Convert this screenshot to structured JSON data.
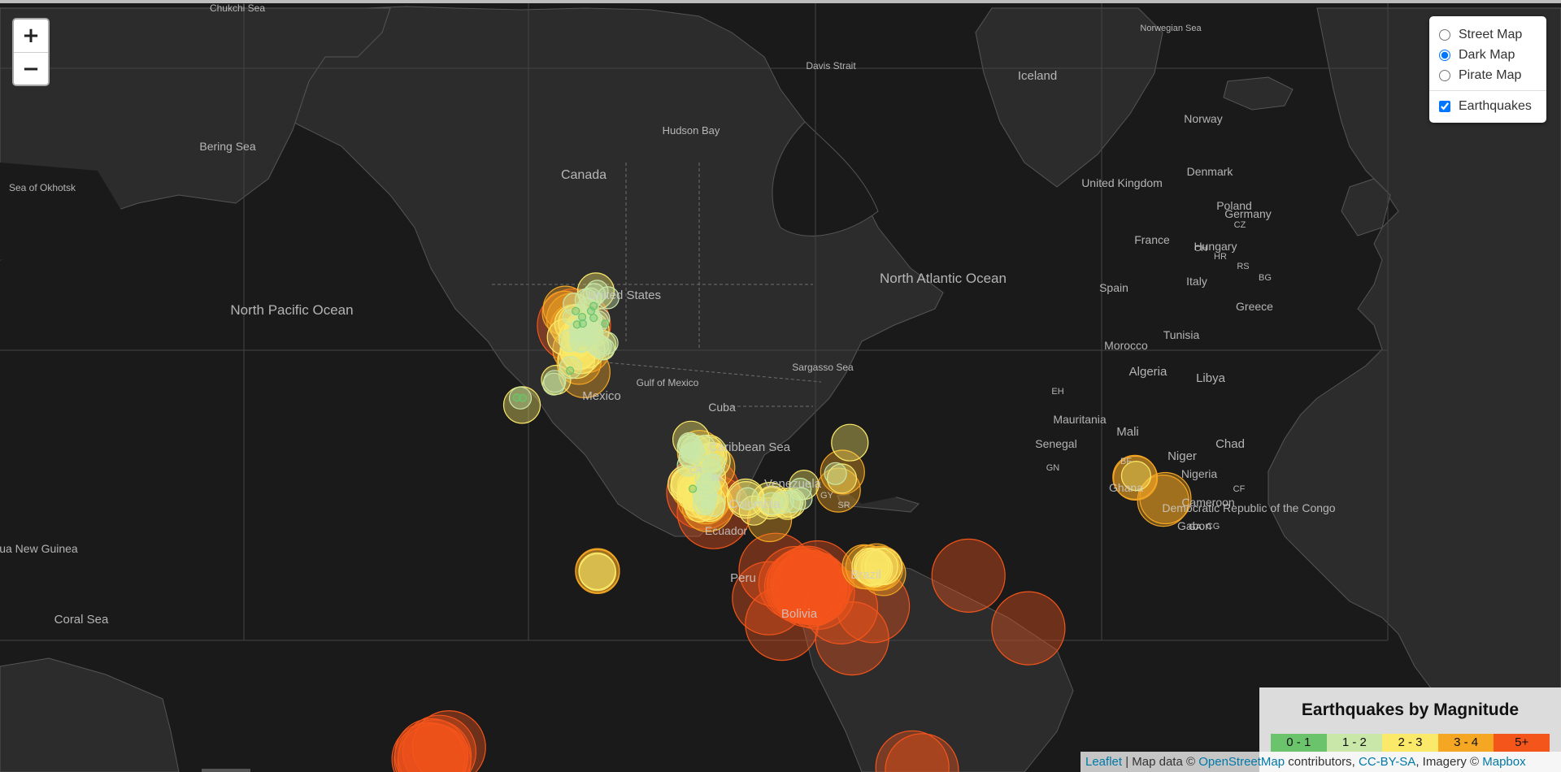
{
  "zoom": {
    "in_label": "+",
    "out_label": "−"
  },
  "layers": {
    "base": [
      {
        "label": "Street Map",
        "checked": false
      },
      {
        "label": "Dark Map",
        "checked": true
      },
      {
        "label": "Pirate Map",
        "checked": false
      }
    ],
    "overlay": {
      "label": "Earthquakes",
      "checked": true
    }
  },
  "legend": {
    "title": "Earthquakes by Magnitude",
    "items": [
      {
        "label": "0 - 1",
        "color": "#6bc46b"
      },
      {
        "label": "1 - 2",
        "color": "#c9e7a8"
      },
      {
        "label": "2 - 3",
        "color": "#fbe96a"
      },
      {
        "label": "3 - 4",
        "color": "#f5a623"
      },
      {
        "label": "5+",
        "color": "#f4551b"
      }
    ]
  },
  "attribution": {
    "leaflet": "Leaflet",
    "sep1": " | Map data © ",
    "osm": "OpenStreetMap",
    "sep2": " contributors, ",
    "license": "CC-BY-SA",
    "sep3": ", Imagery © ",
    "mapbox": "Mapbox"
  },
  "map_labels": [
    "Chukchi Sea",
    "Bering Sea",
    "Sea of Okhotsk",
    "North Pacific Ocean",
    "Canada",
    "Hudson Bay",
    "Davis Strait",
    "United States",
    "Mexico",
    "Gulf of Mexico",
    "Cuba",
    "Caribbean Sea",
    "Sargasso Sea",
    "North Atlantic Ocean",
    "Venezuela",
    "Colombia",
    "Ecuador",
    "Peru",
    "Brazil",
    "Bolivia",
    "Iceland",
    "Norway",
    "Denmark",
    "United Kingdom",
    "Poland",
    "Germany",
    "France",
    "Spain",
    "Italy",
    "Greece",
    "Hungary",
    "Morocco",
    "Tunisia",
    "Algeria",
    "Libya",
    "Mali",
    "Niger",
    "Chad",
    "Mauritania",
    "Senegal",
    "Nigeria",
    "Ghana",
    "Cameroon",
    "Gabon",
    "Democratic Republic of the Congo",
    "Papua New Guinea",
    "Coral Sea",
    "GY",
    "SR",
    "PA",
    "CR",
    "GN",
    "BF",
    "CF",
    "CG",
    "GA",
    "EH",
    "HR",
    "RS",
    "BG",
    "CZ",
    "CH",
    "Norwegian Sea"
  ],
  "basemap_colors": {
    "water": "#1a1a1a",
    "land": "#2c2c2c",
    "border": "#6e6e6e",
    "label": "#cfcfcf"
  },
  "chart_data": {
    "type": "scatter",
    "encoding": "circle position = epicenter on map, circle size and color = magnitude bin",
    "points": [
      {
        "lon": -168.5,
        "lat": 71.6,
        "mag": 3
      },
      {
        "lon": -167.0,
        "lat": 70.7,
        "mag": 1
      },
      {
        "lon": -166.3,
        "lat": 70.5,
        "mag": 3.5
      },
      {
        "lon": -165.8,
        "lat": 69.8,
        "mag": 5
      },
      {
        "lon": -164.9,
        "lat": 70.1,
        "mag": 2.5
      },
      {
        "lon": -164.8,
        "lat": 69.9,
        "mag": 0.5
      },
      {
        "lon": -166.1,
        "lat": 70.0,
        "mag": 2.5
      },
      {
        "lon": -166.2,
        "lat": 69.7,
        "mag": 3
      },
      {
        "lon": -165.2,
        "lat": 71.3,
        "mag": 0.5
      },
      {
        "lon": -163.2,
        "lat": 70.7,
        "mag": 0.5
      },
      {
        "lon": -163.0,
        "lat": 70.0,
        "mag": 0.5
      },
      {
        "lon": -161.6,
        "lat": 71.5,
        "mag": 1.5
      },
      {
        "lon": -162.0,
        "lat": 72.4,
        "mag": 1.5
      },
      {
        "lon": -160.6,
        "lat": 72.5,
        "mag": 1.5
      },
      {
        "lon": -159.4,
        "lat": 72.9,
        "mag": 1.5
      },
      {
        "lon": -158.9,
        "lat": 73.2,
        "mag": 2.5
      },
      {
        "lon": -158.5,
        "lat": 73.2,
        "mag": 1.5
      },
      {
        "lon": -160.4,
        "lat": 71.3,
        "mag": 0.5
      },
      {
        "lon": -159.6,
        "lat": 70.6,
        "mag": 0.5
      },
      {
        "lon": -158.0,
        "lat": 70.5,
        "mag": 1.5
      },
      {
        "lon": -158.4,
        "lat": 70.2,
        "mag": 1.5
      },
      {
        "lon": -165.7,
        "lat": 72.0,
        "mag": 1.5
      },
      {
        "lon": -159.6,
        "lat": 71.8,
        "mag": 0.5
      },
      {
        "lon": -168.8,
        "lat": 71.1,
        "mag": 3
      },
      {
        "lon": -160.4,
        "lat": 70.4,
        "mag": 1.5
      },
      {
        "lon": -161.7,
        "lat": 69.8,
        "mag": 2
      },
      {
        "lon": -163.6,
        "lat": 68.0,
        "mag": 1.5
      },
      {
        "lon": -164.8,
        "lat": 68.4,
        "mag": 2.5
      },
      {
        "lon": -165.2,
        "lat": 67.7,
        "mag": 2
      },
      {
        "lon": -160.4,
        "lat": 69.4,
        "mag": 1.5
      },
      {
        "lon": -163.7,
        "lat": 69.3,
        "mag": 1.5
      },
      {
        "lon": -163.9,
        "lat": 69.5,
        "mag": 2
      },
      {
        "lon": -163.8,
        "lat": 69.6,
        "mag": 2
      },
      {
        "lon": -163.5,
        "lat": 68.1,
        "mag": 1.5
      },
      {
        "lon": -161.2,
        "lat": 68.7,
        "mag": 2
      },
      {
        "lon": -163.5,
        "lat": 68.7,
        "mag": 1.5
      },
      {
        "lon": -160.5,
        "lat": 69.3,
        "mag": 2.5
      },
      {
        "lon": -163.3,
        "lat": 69.4,
        "mag": 1.5
      },
      {
        "lon": -160.4,
        "lat": 70.1,
        "mag": 1.5
      },
      {
        "lon": -161.6,
        "lat": 68.9,
        "mag": 1.5
      },
      {
        "lon": -163.2,
        "lat": 68.9,
        "mag": 2.5
      },
      {
        "lon": -162.1,
        "lat": 69.1,
        "mag": 2
      },
      {
        "lon": -164.4,
        "lat": 66.8,
        "mag": 2.5
      },
      {
        "lon": -165.5,
        "lat": 67.0,
        "mag": 3
      },
      {
        "lon": -165.0,
        "lat": 65.7,
        "mag": 2.5
      },
      {
        "lon": -164.2,
        "lat": 65.4,
        "mag": 3
      },
      {
        "lon": -162.5,
        "lat": 64.1,
        "mag": 3.5
      },
      {
        "lon": -163.5,
        "lat": 66.3,
        "mag": 2.5
      },
      {
        "lon": -161.6,
        "lat": 66.9,
        "mag": 3
      },
      {
        "lon": -161.8,
        "lat": 67.0,
        "mag": 2.5
      },
      {
        "lon": -164.3,
        "lat": 66.9,
        "mag": 2.5
      },
      {
        "lon": -168.4,
        "lat": 68.5,
        "mag": 2.5
      },
      {
        "lon": -167.0,
        "lat": 68.1,
        "mag": 1.5
      },
      {
        "lon": -157.2,
        "lat": 67.6,
        "mag": 2
      },
      {
        "lon": -156.5,
        "lat": 67.1,
        "mag": 1.5
      },
      {
        "lon": -157.5,
        "lat": 67.4,
        "mag": 1.5
      },
      {
        "lon": -158.3,
        "lat": 67.6,
        "mag": 1.5
      },
      {
        "lon": -155.4,
        "lat": 67.8,
        "mag": 1.5
      },
      {
        "lon": -155.1,
        "lat": 72.6,
        "mag": 1.5
      },
      {
        "lon": -156.0,
        "lat": 70.0,
        "mag": 0.5
      },
      {
        "lon": -166.8,
        "lat": 64.7,
        "mag": 1.5
      },
      {
        "lon": -167.0,
        "lat": 64.3,
        "mag": 0.5
      },
      {
        "lon": -171.8,
        "lat": 62.8,
        "mag": 1.5
      },
      {
        "lon": -171.4,
        "lat": 63.0,
        "mag": 2
      },
      {
        "lon": -172.1,
        "lat": 62.4,
        "mag": 1.5
      },
      {
        "lon": -183.7,
        "lat": 60.4,
        "mag": 0.5
      },
      {
        "lon": -182.6,
        "lat": 60.3,
        "mag": 1.5
      },
      {
        "lon": -181.8,
        "lat": 60.3,
        "mag": 0.5
      },
      {
        "lon": -182.1,
        "lat": 59.2,
        "mag": 2.5
      },
      {
        "lon": -129.0,
        "lat": 53.2,
        "mag": 2.5
      },
      {
        "lon": -129.6,
        "lat": 52.4,
        "mag": 1.5
      },
      {
        "lon": -129.5,
        "lat": 52.1,
        "mag": 1.5
      },
      {
        "lon": -129.9,
        "lat": 51.8,
        "mag": 1.5
      },
      {
        "lon": -128.6,
        "lat": 51.4,
        "mag": 1.5
      },
      {
        "lon": -127.6,
        "lat": 51.2,
        "mag": 2
      },
      {
        "lon": -128.2,
        "lat": 50.6,
        "mag": 1.5
      },
      {
        "lon": -129.8,
        "lat": 50.2,
        "mag": 1
      },
      {
        "lon": -129.4,
        "lat": 49.9,
        "mag": 1.5
      },
      {
        "lon": -128.1,
        "lat": 49.9,
        "mag": 2
      },
      {
        "lon": -126.4,
        "lat": 50.7,
        "mag": 3
      },
      {
        "lon": -129.9,
        "lat": 48.1,
        "mag": 1.5
      },
      {
        "lon": -125.0,
        "lat": 51.9,
        "mag": 1.5
      },
      {
        "lon": -123.4,
        "lat": 50.9,
        "mag": 2
      },
      {
        "lon": -123.6,
        "lat": 50.5,
        "mag": 2.5
      },
      {
        "lon": -122.4,
        "lat": 49.6,
        "mag": 2
      },
      {
        "lon": -122.5,
        "lat": 49.0,
        "mag": 2.5
      },
      {
        "lon": -121.9,
        "lat": 48.1,
        "mag": 1.5
      },
      {
        "lon": -123.1,
        "lat": 49.6,
        "mag": 2
      },
      {
        "lon": -122.2,
        "lat": 47.6,
        "mag": 3
      },
      {
        "lon": -122.9,
        "lat": 47.0,
        "mag": 1.5
      },
      {
        "lon": -122.3,
        "lat": 48.7,
        "mag": 1
      },
      {
        "lon": -122.8,
        "lat": 45.5,
        "mag": 2
      },
      {
        "lon": -123.7,
        "lat": 44.9,
        "mag": 1
      },
      {
        "lon": -124.2,
        "lat": 45.0,
        "mag": 1.5
      },
      {
        "lon": -123.5,
        "lat": 43.9,
        "mag": 1.5
      },
      {
        "lon": -123.9,
        "lat": 43.3,
        "mag": 1.5
      },
      {
        "lon": -130.7,
        "lat": 44.4,
        "mag": 2
      },
      {
        "lon": -130.5,
        "lat": 44.0,
        "mag": 2.5
      },
      {
        "lon": -129.7,
        "lat": 43.5,
        "mag": 2.5
      },
      {
        "lon": -129.4,
        "lat": 43.9,
        "mag": 2.5
      },
      {
        "lon": -128.6,
        "lat": 43.7,
        "mag": 2
      },
      {
        "lon": -128.4,
        "lat": 43.2,
        "mag": 3
      },
      {
        "lon": -128.5,
        "lat": 42.9,
        "mag": 0.5
      },
      {
        "lon": -127.3,
        "lat": 42.6,
        "mag": 2.5
      },
      {
        "lon": -127.1,
        "lat": 42.0,
        "mag": 2.5
      },
      {
        "lon": -125.2,
        "lat": 42.0,
        "mag": 5
      },
      {
        "lon": -125.2,
        "lat": 42.3,
        "mag": 2.5
      },
      {
        "lon": -126.4,
        "lat": 42.1,
        "mag": 2
      },
      {
        "lon": -125.7,
        "lat": 41.0,
        "mag": 2
      },
      {
        "lon": -126.4,
        "lat": 40.4,
        "mag": 3
      },
      {
        "lon": -127.7,
        "lat": 41.9,
        "mag": 2.5
      },
      {
        "lon": -125.0,
        "lat": 41.4,
        "mag": 1.5
      },
      {
        "lon": -125.0,
        "lat": 40.5,
        "mag": 2
      },
      {
        "lon": -124.3,
        "lat": 39.8,
        "mag": 3
      },
      {
        "lon": -124.9,
        "lat": 39.3,
        "mag": 1.5
      },
      {
        "lon": -123.8,
        "lat": 38.8,
        "mag": 3.5
      },
      {
        "lon": -123.1,
        "lat": 38.6,
        "mag": 2
      },
      {
        "lon": -123.7,
        "lat": 40.4,
        "mag": 3
      },
      {
        "lon": -126.9,
        "lat": 39.6,
        "mag": 2
      },
      {
        "lon": -124.0,
        "lat": 39.9,
        "mag": 2.5
      },
      {
        "lon": -124.5,
        "lat": 38.9,
        "mag": 1
      },
      {
        "lon": -124.5,
        "lat": 40.8,
        "mag": 1.5
      },
      {
        "lon": -122.1,
        "lat": 42.7,
        "mag": 2
      },
      {
        "lon": -121.8,
        "lat": 39.0,
        "mag": 1.5
      },
      {
        "lon": -126.3,
        "lat": 38.5,
        "mag": 2
      },
      {
        "lon": -121.9,
        "lat": 37.3,
        "mag": 5
      },
      {
        "lon": -111.9,
        "lat": 40.9,
        "mag": 2.5
      },
      {
        "lon": -111.8,
        "lat": 40.3,
        "mag": 2.5
      },
      {
        "lon": -111.3,
        "lat": 40.6,
        "mag": 1.5
      },
      {
        "lon": -104.3,
        "lat": 40.1,
        "mag": 2.5
      },
      {
        "lon": -103.7,
        "lat": 40.1,
        "mag": 2
      },
      {
        "lon": -103.7,
        "lat": 39.8,
        "mag": 2
      },
      {
        "lon": -103.8,
        "lat": 39.4,
        "mag": 1.5
      },
      {
        "lon": -109.3,
        "lat": 37.7,
        "mag": 2
      },
      {
        "lon": -104.4,
        "lat": 35.4,
        "mag": 3
      },
      {
        "lon": -100.3,
        "lat": 39.7,
        "mag": 1.5
      },
      {
        "lon": -99.3,
        "lat": 39.6,
        "mag": 2
      },
      {
        "lon": -98.8,
        "lat": 39.1,
        "mag": 2
      },
      {
        "lon": -97.7,
        "lat": 39.6,
        "mag": 2
      },
      {
        "lon": -97.3,
        "lat": 39.9,
        "mag": 1.5
      },
      {
        "lon": -94.8,
        "lat": 42.8,
        "mag": 1.5
      },
      {
        "lon": -93.6,
        "lat": 43.8,
        "mag": 2
      },
      {
        "lon": -94.5,
        "lat": 40.6,
        "mag": 1.5
      },
      {
        "lon": -79.2,
        "lat": 52.6,
        "mag": 2.5
      },
      {
        "lon": -83.7,
        "lat": 46.3,
        "mag": 1.5
      },
      {
        "lon": -81.5,
        "lat": 46.6,
        "mag": 3
      },
      {
        "lon": -81.7,
        "lat": 45.2,
        "mag": 2
      },
      {
        "lon": -82.8,
        "lat": 42.6,
        "mag": 3
      },
      {
        "lon": -158.4,
        "lat": 21.1,
        "mag": 3
      },
      {
        "lon": -158.4,
        "lat": 21.4,
        "mag": 3
      },
      {
        "lon": -158.5,
        "lat": 21.2,
        "mag": 2.5
      },
      {
        "lon": -158.4,
        "lat": 20.9,
        "mag": 2.5
      },
      {
        "lon": -102.5,
        "lat": 21.6,
        "mag": 5
      },
      {
        "lon": -104.6,
        "lat": 13.1,
        "mag": 5
      },
      {
        "lon": -96.3,
        "lat": 17.7,
        "mag": 5
      },
      {
        "lon": -94.5,
        "lat": 16.6,
        "mag": 5
      },
      {
        "lon": -93.8,
        "lat": 16.8,
        "mag": 5
      },
      {
        "lon": -93.4,
        "lat": 17.4,
        "mag": 5
      },
      {
        "lon": -92.6,
        "lat": 17.8,
        "mag": 5
      },
      {
        "lon": -92.3,
        "lat": 16.5,
        "mag": 5
      },
      {
        "lon": -92.0,
        "lat": 15.4,
        "mag": 5
      },
      {
        "lon": -91.8,
        "lat": 16.6,
        "mag": 5
      },
      {
        "lon": -91.6,
        "lat": 16.2,
        "mag": 5
      },
      {
        "lon": -90.8,
        "lat": 16.3,
        "mag": 5
      },
      {
        "lon": -90.5,
        "lat": 16.1,
        "mag": 5
      },
      {
        "lon": -89.3,
        "lat": 19.4,
        "mag": 5
      },
      {
        "lon": -89.2,
        "lat": 14.8,
        "mag": 5
      },
      {
        "lon": -100.5,
        "lat": 5.2,
        "mag": 5
      },
      {
        "lon": -72.0,
        "lat": 10.7,
        "mag": 5
      },
      {
        "lon": -78.5,
        "lat": 0.6,
        "mag": 5
      },
      {
        "lon": -82.0,
        "lat": 10.3,
        "mag": 5
      },
      {
        "lon": -74.7,
        "lat": 22.5,
        "mag": 3
      },
      {
        "lon": -73.6,
        "lat": 22.4,
        "mag": 3
      },
      {
        "lon": -72.8,
        "lat": 22.6,
        "mag": 2.5
      },
      {
        "lon": -72.1,
        "lat": 22.4,
        "mag": 2.5
      },
      {
        "lon": -70.9,
        "lat": 22.8,
        "mag": 3
      },
      {
        "lon": -71.6,
        "lat": 22.0,
        "mag": 2.5
      },
      {
        "lon": -70.4,
        "lat": 22.0,
        "mag": 3
      },
      {
        "lon": -69.9,
        "lat": 22.5,
        "mag": 2.5
      },
      {
        "lon": -69.5,
        "lat": 22.1,
        "mag": 3
      },
      {
        "lon": -68.7,
        "lat": 22.6,
        "mag": 2.5
      },
      {
        "lon": -68.6,
        "lat": 20.5,
        "mag": 3
      },
      {
        "lon": -42.0,
        "lat": 19.9,
        "mag": 5
      },
      {
        "lon": -23.2,
        "lat": 3.8,
        "mag": 5
      },
      {
        "lon": 10.2,
        "lat": 45.5,
        "mag": 3
      },
      {
        "lon": 10.4,
        "lat": 45.3,
        "mag": 3
      },
      {
        "lon": 10.6,
        "lat": 45.8,
        "mag": 2
      },
      {
        "lon": 19.1,
        "lat": 40.1,
        "mag": 3.5
      },
      {
        "lon": 19.8,
        "lat": 40.7,
        "mag": 3.5
      },
      {
        "lon": -208.0,
        "lat": -33.0,
        "mag": 5
      },
      {
        "lon": -209.5,
        "lat": -34.2,
        "mag": 5
      },
      {
        "lon": -210.5,
        "lat": -33.9,
        "mag": 5
      },
      {
        "lon": -210.7,
        "lat": -35.0,
        "mag": 5
      },
      {
        "lon": -209.6,
        "lat": -35.3,
        "mag": 5
      },
      {
        "lon": -211.4,
        "lat": -34.9,
        "mag": 5
      },
      {
        "lon": -205.0,
        "lat": -31.8,
        "mag": 5
      },
      {
        "lon": -59.6,
        "lat": -37.0,
        "mag": 5
      },
      {
        "lon": -56.6,
        "lat": -37.7,
        "mag": 5
      }
    ]
  }
}
